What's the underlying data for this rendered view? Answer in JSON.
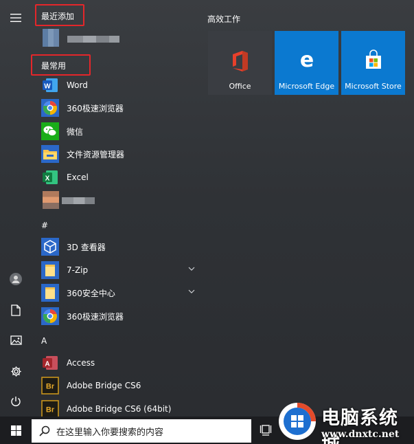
{
  "sections": {
    "recently_added": "最近添加",
    "most_used": "最常用",
    "hash": "#",
    "letter_a": "A"
  },
  "most_used_apps": [
    {
      "name": "Word",
      "icon": "word-icon"
    },
    {
      "name": "360极速浏览器",
      "icon": "360-browser-icon"
    },
    {
      "name": "微信",
      "icon": "wechat-icon"
    },
    {
      "name": "文件资源管理器",
      "icon": "file-explorer-icon"
    },
    {
      "name": "Excel",
      "icon": "excel-icon"
    }
  ],
  "hash_apps": [
    {
      "name": "3D 查看器",
      "icon": "3d-viewer-icon"
    },
    {
      "name": "7-Zip",
      "icon": "folder-icon",
      "expandable": true
    },
    {
      "name": "360安全中心",
      "icon": "folder-icon",
      "expandable": true
    },
    {
      "name": "360极速浏览器",
      "icon": "360-browser-icon"
    }
  ],
  "a_apps": [
    {
      "name": "Access",
      "icon": "access-icon"
    },
    {
      "name": "Adobe Bridge CS6",
      "icon": "adobe-bridge-icon"
    },
    {
      "name": "Adobe Bridge CS6 (64bit)",
      "icon": "adobe-bridge-icon"
    }
  ],
  "tiles": {
    "group_title": "高效工作",
    "items": [
      {
        "label": "Office",
        "icon": "office-icon",
        "color": "#3a3d42"
      },
      {
        "label": "Microsoft Edge",
        "icon": "edge-icon",
        "color": "#0b79d0"
      },
      {
        "label": "Microsoft Store",
        "icon": "store-icon",
        "color": "#0b79d0"
      }
    ]
  },
  "taskbar": {
    "search_placeholder": "在这里输入你要搜索的内容"
  },
  "watermark": {
    "title": "电脑系统城",
    "url": "www.dnxtc.net"
  },
  "colors": {
    "highlight_box": "#e5262a",
    "tile_blue": "#0b79d0",
    "taskbar": "#1c1d20"
  }
}
